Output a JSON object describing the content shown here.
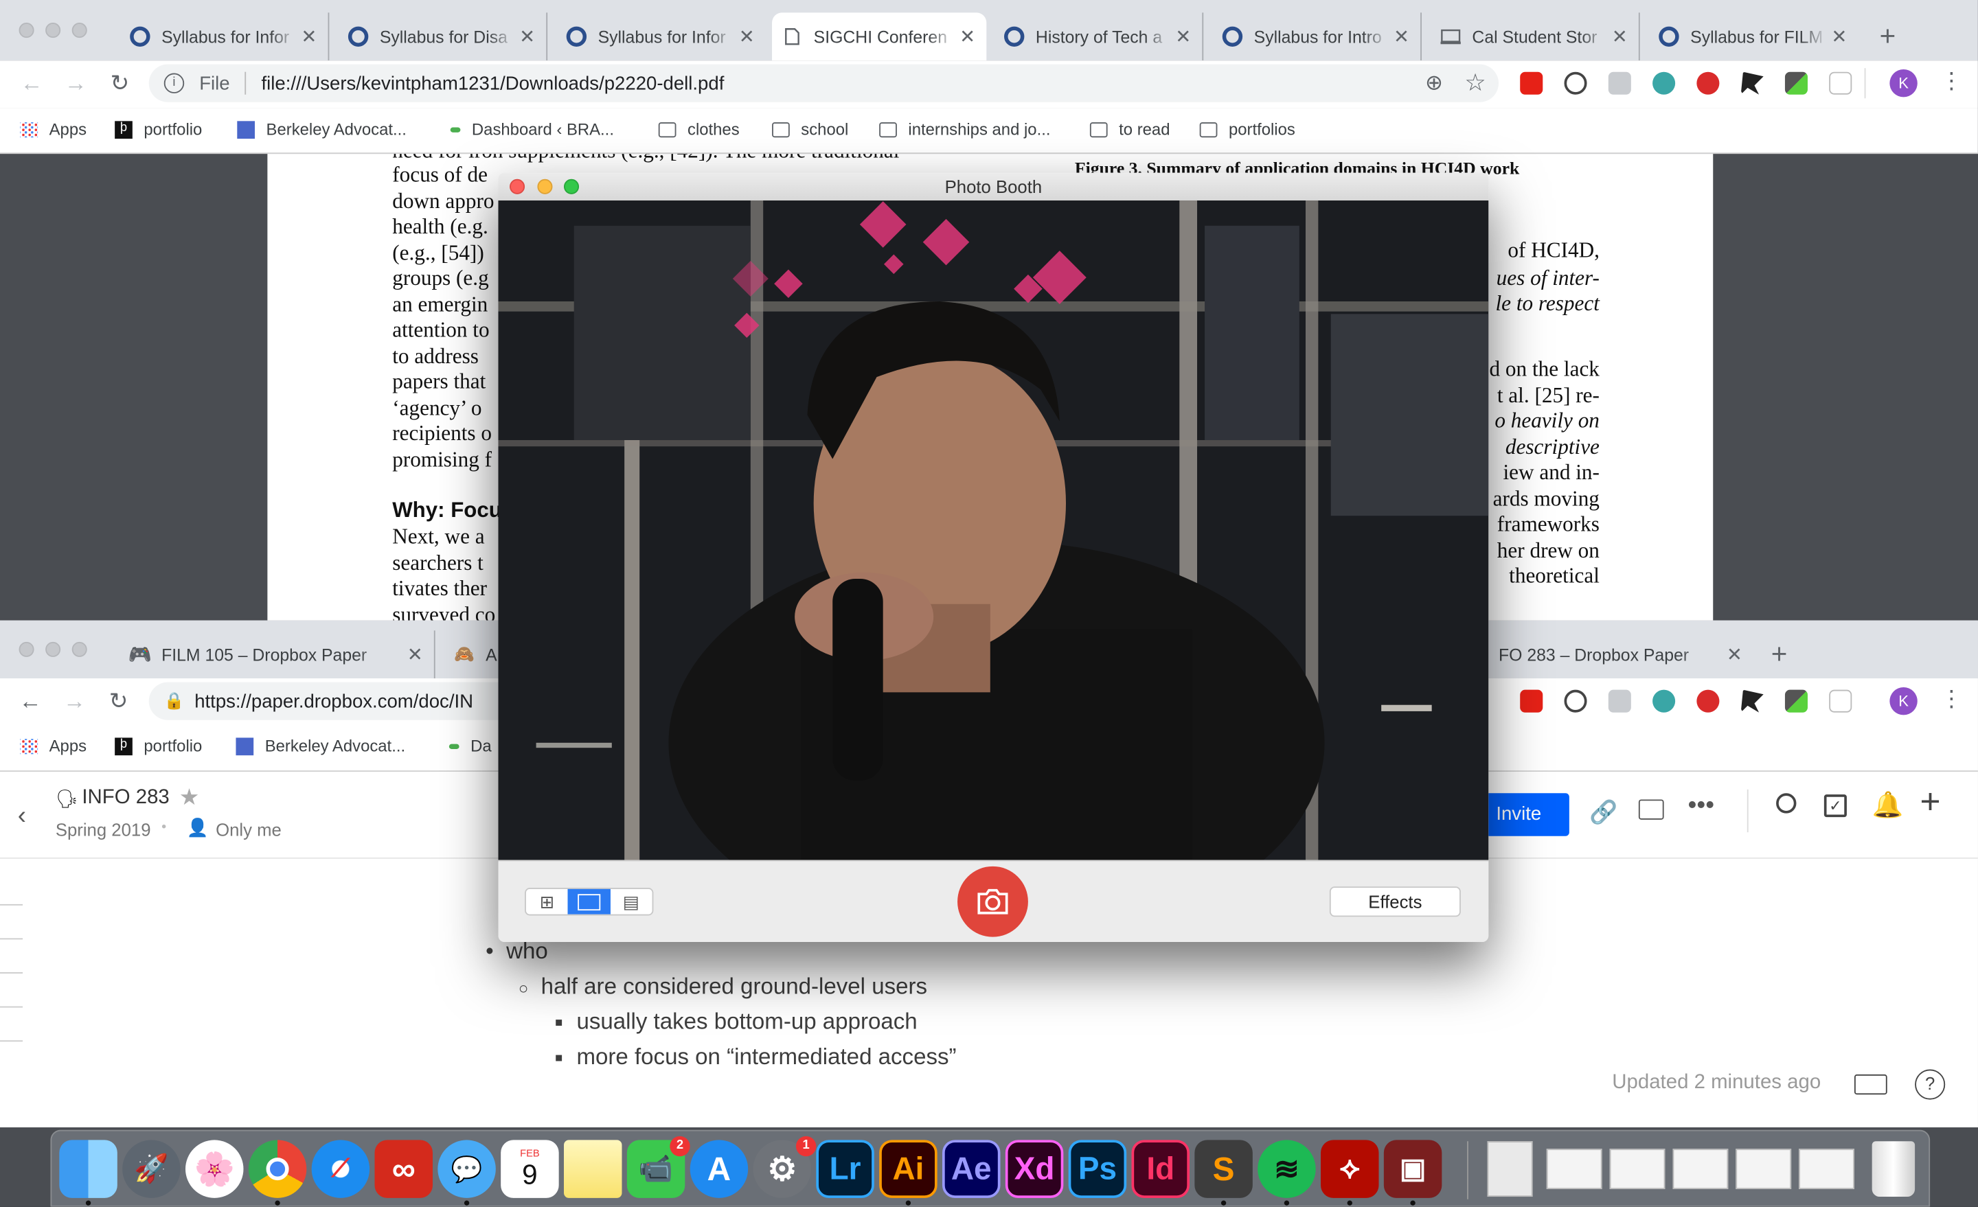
{
  "top_window": {
    "tabs": [
      {
        "title": "Syllabus for Infor",
        "favicon": "canvas-icon"
      },
      {
        "title": "Syllabus for Disa",
        "favicon": "canvas-icon"
      },
      {
        "title": "Syllabus for Infor",
        "favicon": "canvas-icon"
      },
      {
        "title": "SIGCHI Conferen",
        "favicon": "document-icon"
      },
      {
        "title": "History of Tech a",
        "favicon": "canvas-icon"
      },
      {
        "title": "Syllabus for Intro",
        "favicon": "canvas-icon"
      },
      {
        "title": "Cal Student Stor",
        "favicon": "store-icon"
      },
      {
        "title": "Syllabus for FILM",
        "favicon": "canvas-icon"
      }
    ],
    "address_scheme": "File",
    "address_url": "file:///Users/kevintpham1231/Downloads/p2220-dell.pdf",
    "profile_initial": "K",
    "bookmarks": [
      "Apps",
      "portfolio",
      "Berkeley Advocat...",
      "Dashboard ‹ BRA...",
      "clothes",
      "school",
      "internships and jo...",
      "to read",
      "portfolios"
    ]
  },
  "pdf": {
    "left_lines": [
      "need for iron supplements (e.g., [42]). The more traditional",
      "focus of de",
      "down appro",
      "health (e.g.",
      "(e.g., [54])",
      "groups (e.g",
      "an emergin",
      "attention to",
      "to address",
      "papers that",
      "‘agency’ o",
      "recipients o",
      "promising f",
      "Why: Focu",
      "Next, we a",
      "searchers t",
      "tivates ther",
      "surveyed co"
    ],
    "right_lines": [
      "Figure 3. Summary of application domains in HCI4D work",
      "of HCI4D,",
      "ues of inter-",
      "le to respect",
      "d on the lack",
      "t al. [25] re-",
      "o heavily on",
      "descriptive",
      "iew and in-",
      "ards moving",
      "frameworks",
      "her drew on",
      "theoretical"
    ]
  },
  "bottom_window": {
    "tabs": [
      {
        "title": "FILM 105 – Dropbox Paper",
        "favicon": "gamepad-icon"
      },
      {
        "title": "A",
        "favicon": "monkey-icon"
      },
      {
        "title": "FO 283 – Dropbox Paper",
        "favicon": "paper-icon"
      }
    ],
    "address_url": "https://paper.dropbox.com/doc/IN",
    "profile_initial": "K",
    "bookmarks": [
      "Apps",
      "portfolio",
      "Berkeley Advocat...",
      "Da"
    ]
  },
  "paper": {
    "doc_title": "INFO 283",
    "folder": "Spring 2019",
    "sharing": "Only me",
    "invite_label": "Invite",
    "updated": "Updated 2 minutes ago",
    "bullets": [
      {
        "level": 1,
        "text": "who"
      },
      {
        "level": 2,
        "text": "half are considered ground-level users"
      },
      {
        "level": 3,
        "text": "usually takes bottom-up approach"
      },
      {
        "level": 3,
        "text": "more focus on “intermediated access”"
      }
    ]
  },
  "photo_booth": {
    "title": "Photo Booth",
    "effects_label": "Effects"
  },
  "dock": {
    "apps": [
      {
        "name": "finder-icon"
      },
      {
        "name": "launchpad-icon"
      },
      {
        "name": "photos-icon"
      },
      {
        "name": "chrome-icon"
      },
      {
        "name": "safari-icon"
      },
      {
        "name": "creative-cloud-icon"
      },
      {
        "name": "messages-icon"
      },
      {
        "name": "calendar-icon",
        "label": "9",
        "month": "FEB"
      },
      {
        "name": "notes-icon"
      },
      {
        "name": "facetime-icon",
        "badge": "2"
      },
      {
        "name": "app-store-icon"
      },
      {
        "name": "system-preferences-icon",
        "badge": "1"
      },
      {
        "name": "lightroom-icon",
        "label": "Lr"
      },
      {
        "name": "illustrator-icon",
        "label": "Ai"
      },
      {
        "name": "after-effects-icon",
        "label": "Ae"
      },
      {
        "name": "xd-icon",
        "label": "Xd"
      },
      {
        "name": "photoshop-icon",
        "label": "Ps"
      },
      {
        "name": "indesign-icon",
        "label": "Id"
      },
      {
        "name": "sublime-icon",
        "label": "S"
      },
      {
        "name": "spotify-icon"
      },
      {
        "name": "acrobat-icon"
      },
      {
        "name": "photo-booth-icon"
      }
    ]
  },
  "colors": {
    "chrome_tab_bg": "#dee1e6",
    "invite_blue": "#0061fe",
    "shutter_red": "#e0453b",
    "adobe_lr": "#31a8ff",
    "adobe_ai": "#ff9a00",
    "adobe_ae": "#9999ff",
    "adobe_xd": "#ff61f6",
    "adobe_ps": "#31a8ff",
    "adobe_id": "#ff3366"
  }
}
